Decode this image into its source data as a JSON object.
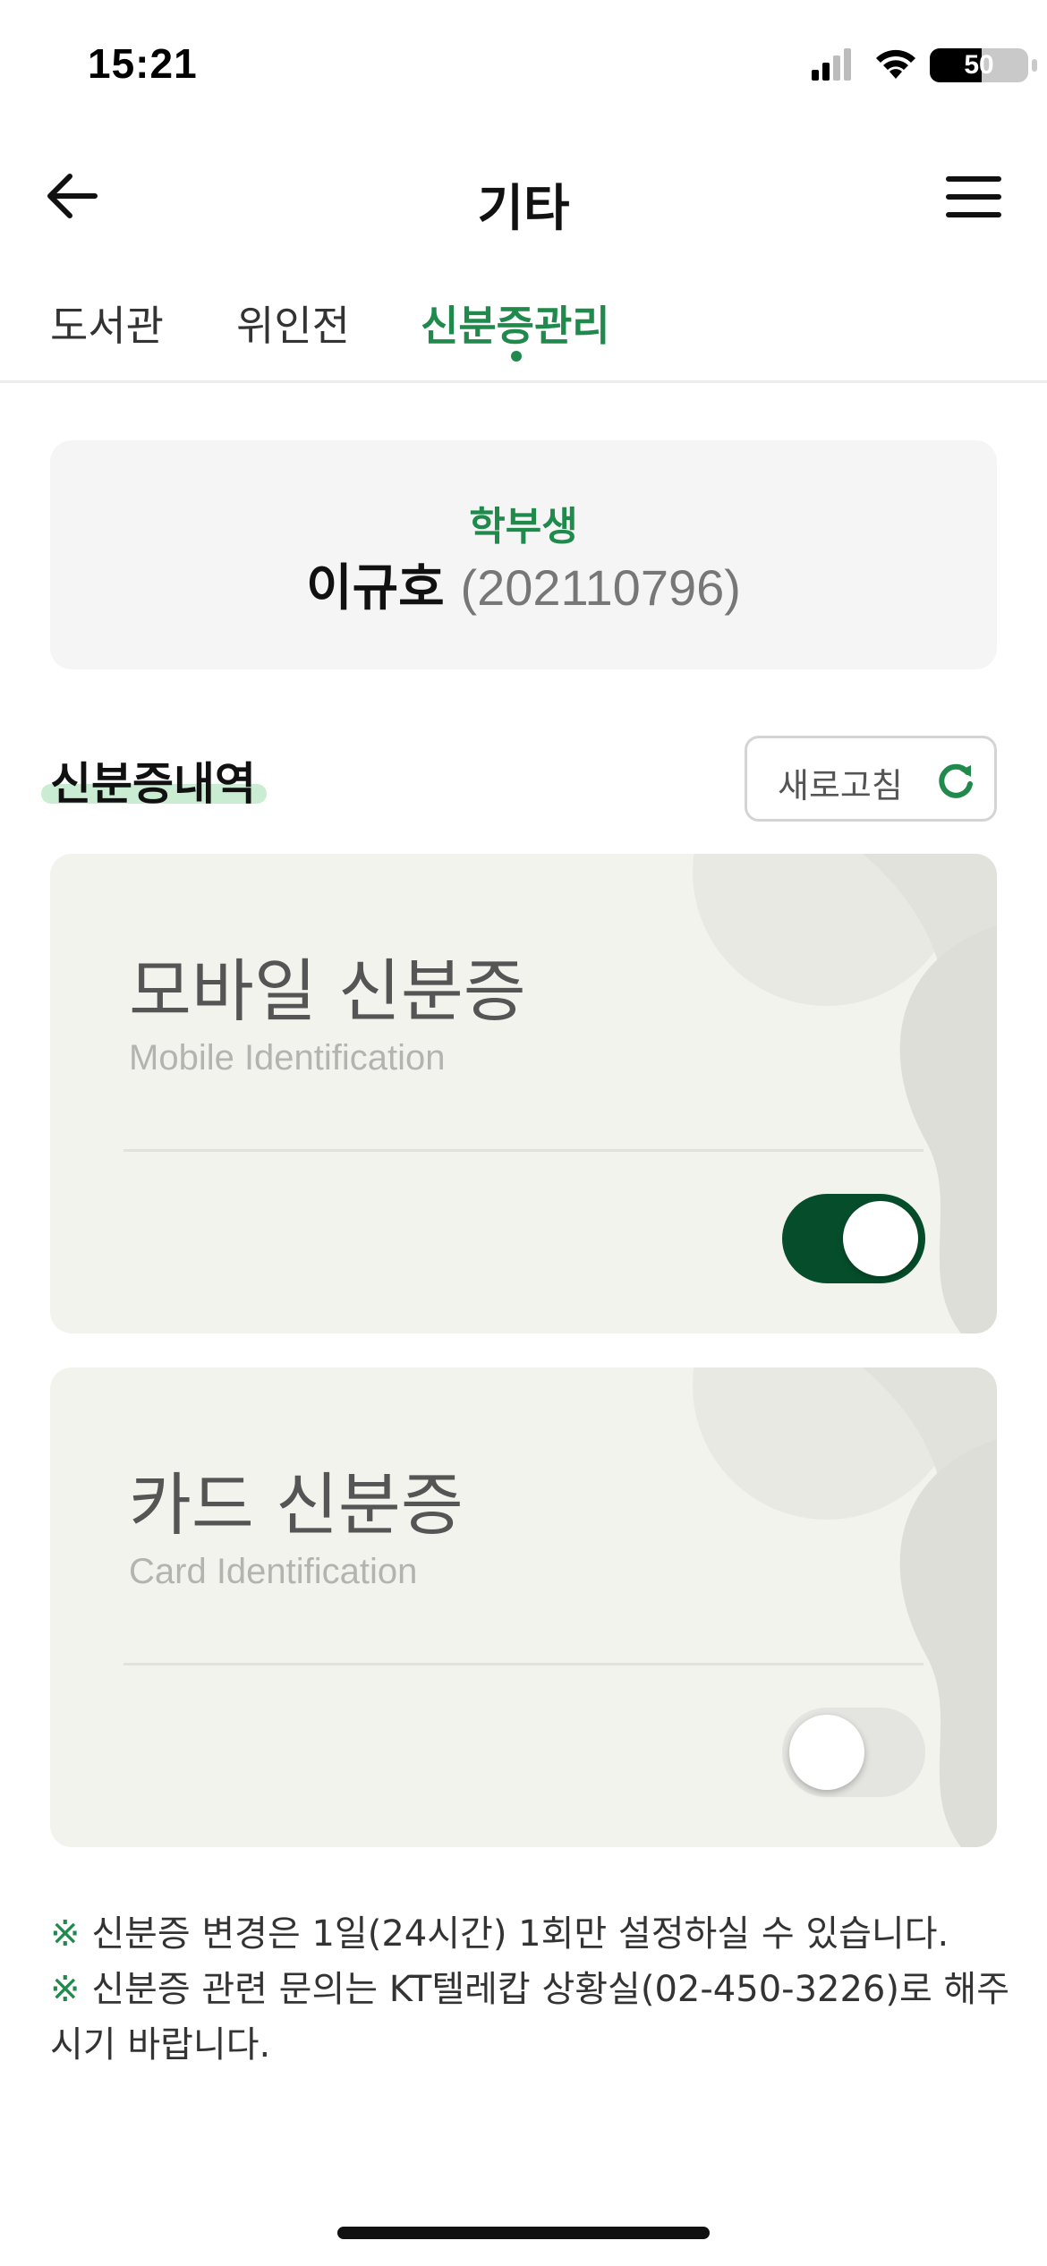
{
  "status_bar": {
    "time": "15:21",
    "battery_level": "50"
  },
  "header": {
    "title": "기타"
  },
  "tabs": [
    {
      "label": "도서관",
      "active": false
    },
    {
      "label": "위인전",
      "active": false
    },
    {
      "label": "신분증관리",
      "active": true
    }
  ],
  "profile": {
    "type": "학부생",
    "name": "이규호",
    "student_id": "(202110796)"
  },
  "section": {
    "title": "신분증내역",
    "refresh_label": "새로고침"
  },
  "cards": [
    {
      "title": "모바일 신분증",
      "subtitle": "Mobile Identification",
      "enabled": true
    },
    {
      "title": "카드 신분증",
      "subtitle": "Card Identification",
      "enabled": false
    }
  ],
  "notes": {
    "mark": "※",
    "line1": "신분증 변경은 1일(24시간) 1회만 설정하실 수 있습니다.",
    "line2": "신분증 관련 문의는 KT텔레캅 상황실(02-450-3226)로 해주시기 바랍니다."
  },
  "colors": {
    "accent": "#1f8a4c",
    "toggle_on": "#064e2b",
    "card_bg": "#f3f3ee"
  }
}
